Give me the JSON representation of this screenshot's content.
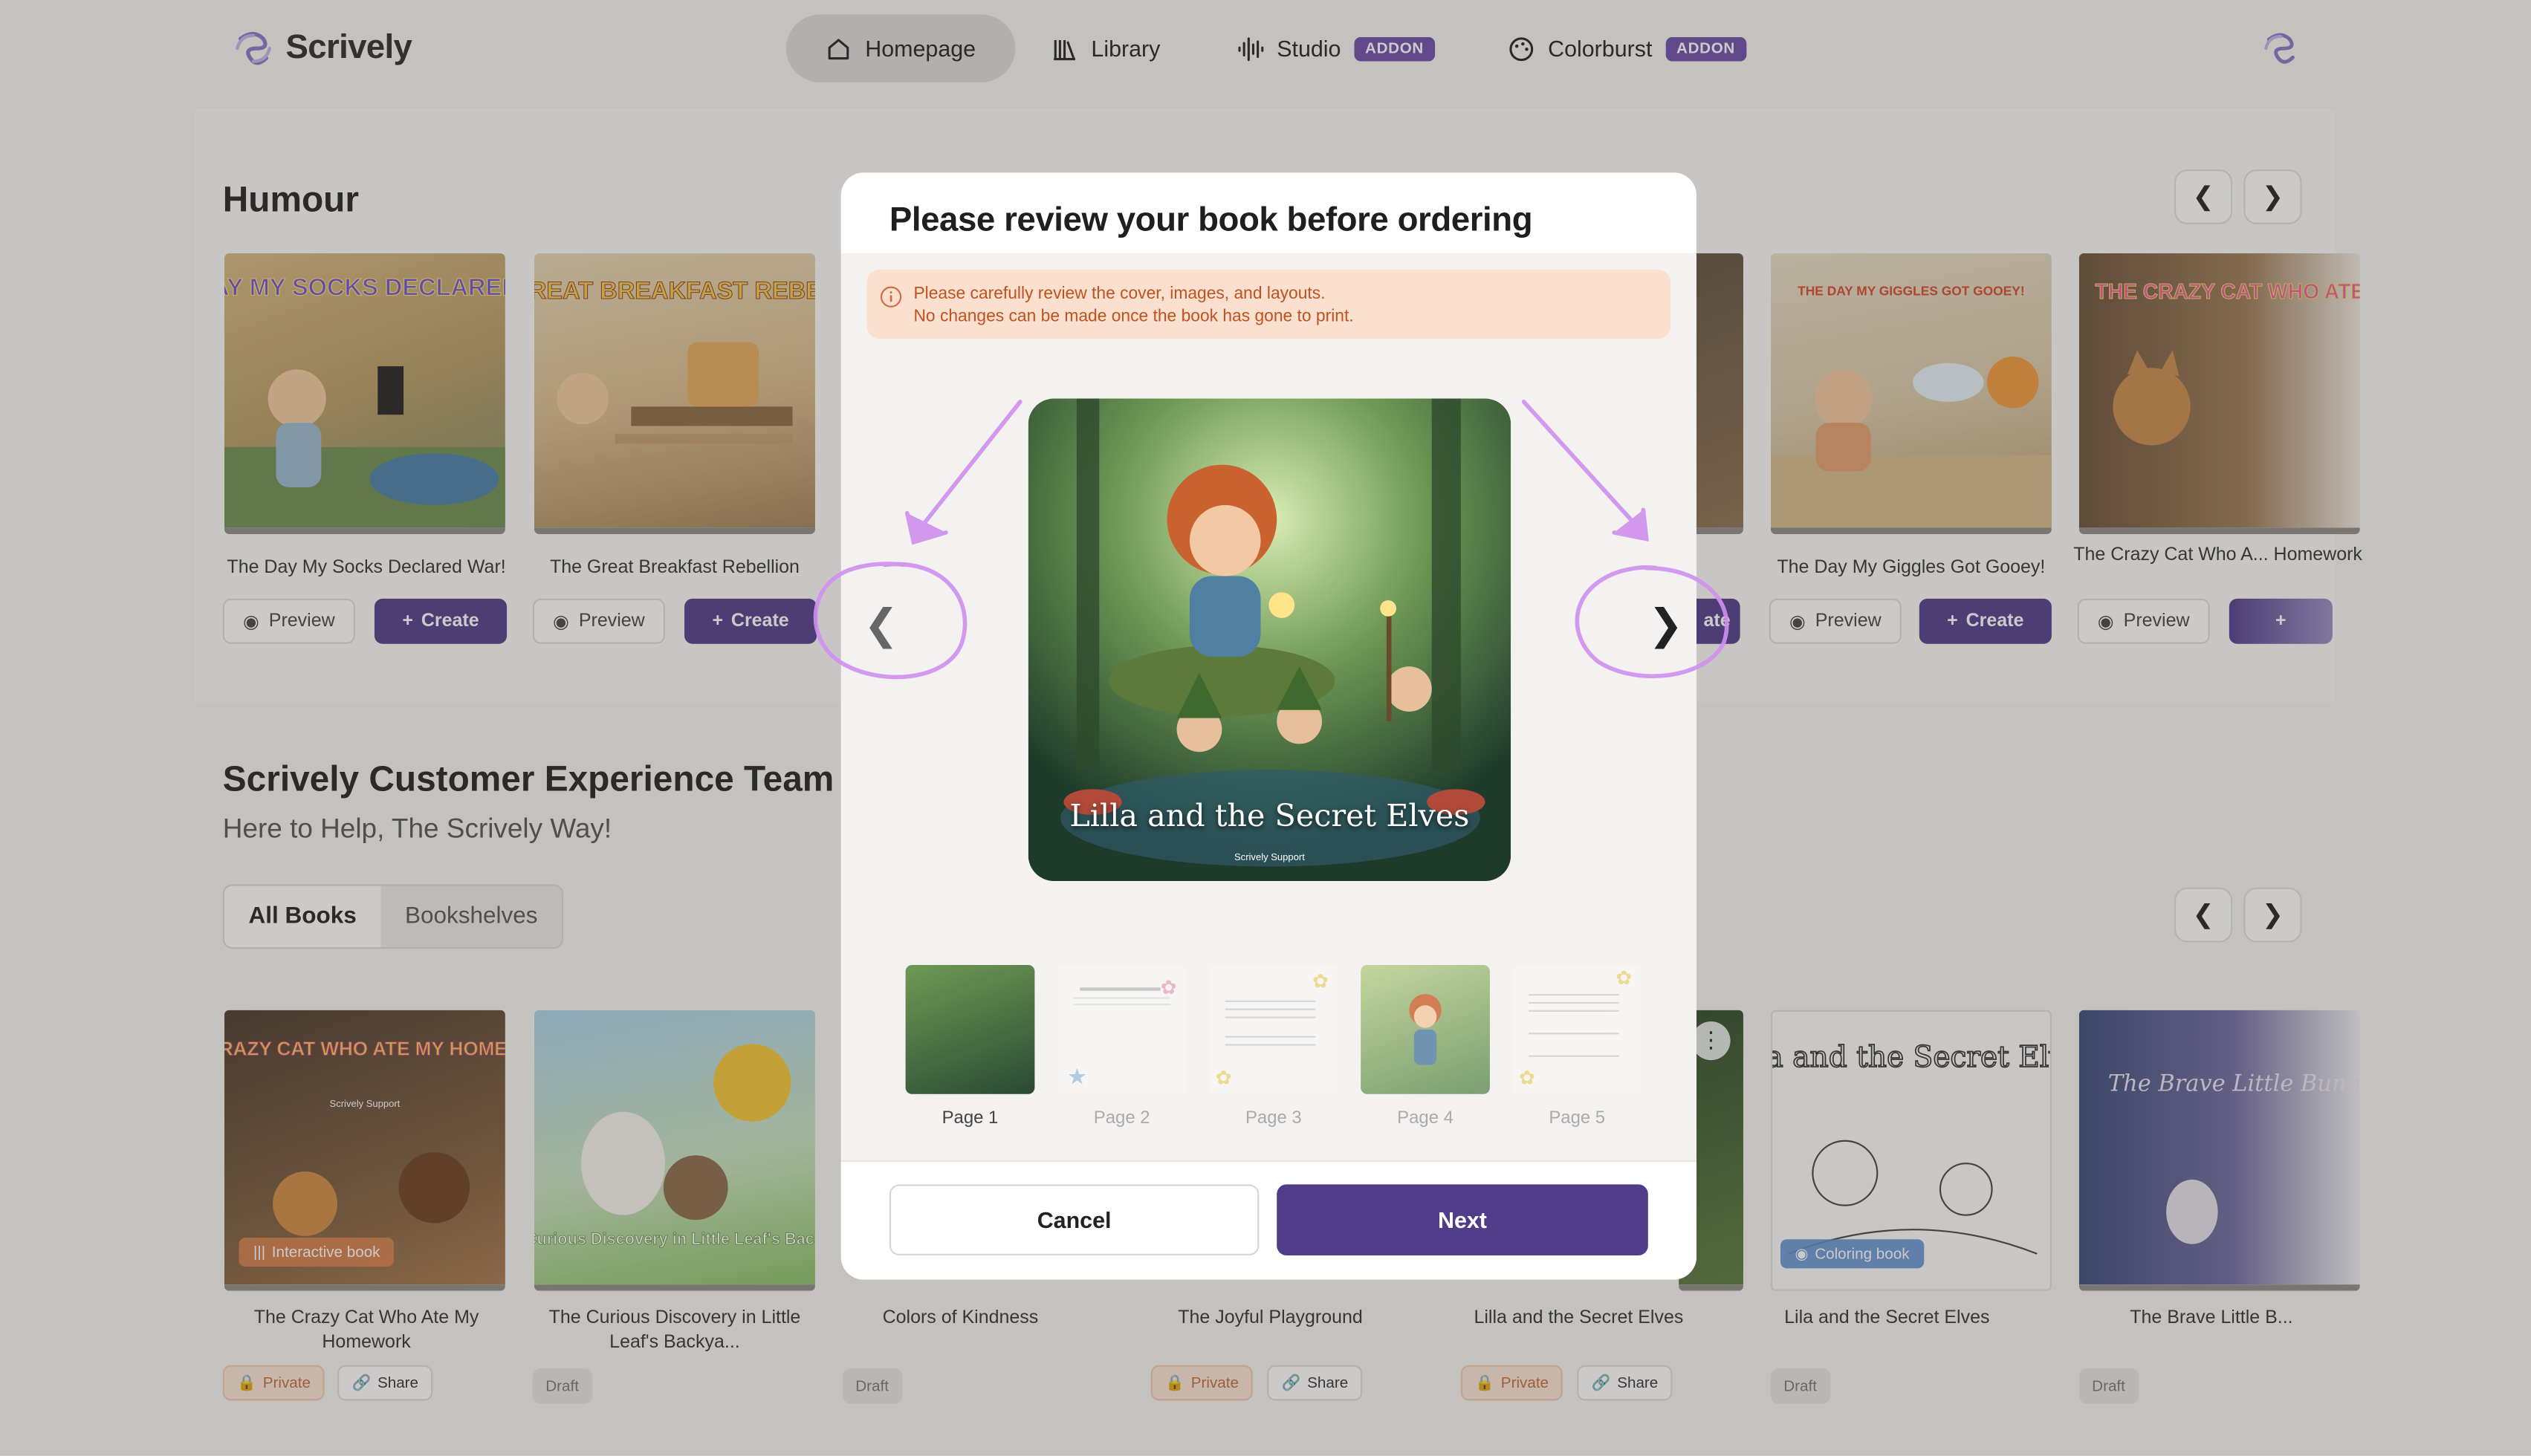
{
  "app": {
    "name": "Scrively"
  },
  "nav": {
    "items": [
      {
        "label": "Homepage"
      },
      {
        "label": "Library"
      },
      {
        "label": "Studio",
        "badge": "ADDON"
      },
      {
        "label": "Colorburst",
        "badge": "ADDON"
      }
    ]
  },
  "humour": {
    "title": "Humour",
    "books": [
      {
        "title": "The Day My Socks Declared War!"
      },
      {
        "title": "The Great Breakfast Rebellion"
      },
      {
        "title": "The Day My Giggles Got Gooey!"
      },
      {
        "title": "The Crazy Cat Who A... Homework"
      }
    ],
    "preview_label": "Preview",
    "create_label": "Create",
    "partial_create": "ate"
  },
  "team": {
    "title": "Scrively Customer Experience Team",
    "subtitle": "Here to Help, The Scrively Way!",
    "tabs": [
      "All Books",
      "Bookshelves"
    ],
    "books": [
      {
        "title": "The Crazy Cat Who Ate My Homework"
      },
      {
        "title": "The Curious Discovery in Little Leaf's Backya..."
      },
      {
        "title": "Colors of Kindness"
      },
      {
        "title": "The Joyful Playground"
      },
      {
        "title": "Lilla and the Secret Elves"
      },
      {
        "title": "Lila and the Secret Elves"
      },
      {
        "title": "The Brave Little B..."
      }
    ],
    "private_label": "Private",
    "share_label": "Share",
    "draft_label": "Draft",
    "interactive_tag": "Interactive book",
    "coloring_tag": "Coloring book"
  },
  "cover_art_text": {
    "socks": "THE DAY MY SOCKS DECLARED WAR!",
    "breakfast": "THE GREAT BREAKFAST REBELLION",
    "giggles": "THE DAY MY GIGGLES GOT GOOEY!",
    "cat": "THE CRAZY CAT WHO ATE MY HOMEWORK",
    "cat_author": "Scrively Support",
    "curious": "The Curious Discovery in Little Leaf's Backyard",
    "coloring": "Lila and the Secret Elves",
    "bunny": "The Brave Little Bunny"
  },
  "modal": {
    "title": "Please review your book before ordering",
    "warning_line1": "Please carefully review the cover, images, and layouts.",
    "warning_line2": "No changes can be made once the book has gone to print.",
    "cover_title": "Lilla and the Secret Elves",
    "cover_author": "Scrively Support",
    "pages": [
      {
        "label": "Page 1",
        "active": true
      },
      {
        "label": "Page 2"
      },
      {
        "label": "Page 3"
      },
      {
        "label": "Page 4"
      },
      {
        "label": "Page 5"
      }
    ],
    "cancel_label": "Cancel",
    "next_label": "Next"
  },
  "colors": {
    "primary": "#4f3d8a",
    "badge": "#6b4ca8",
    "warning_bg": "#fbe0cf",
    "warning_text": "#c0521f",
    "annotation": "#cf8fee"
  }
}
